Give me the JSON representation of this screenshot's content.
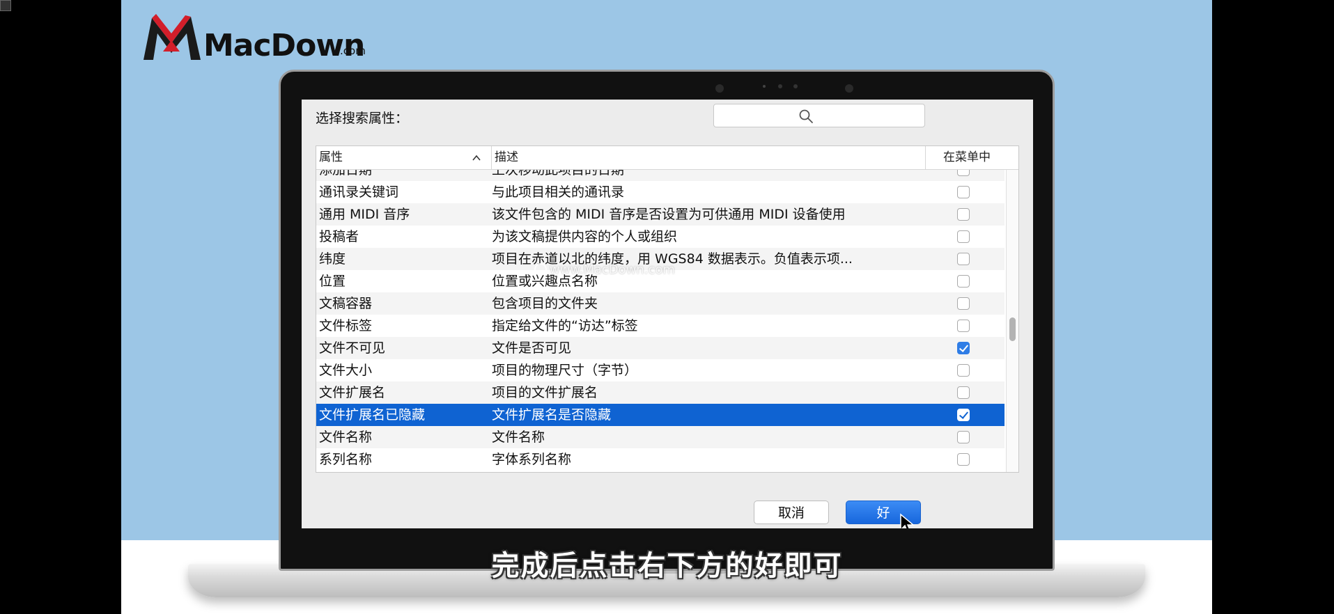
{
  "logo": {
    "brand": "MacDown",
    "brand_suffix": ".com"
  },
  "dialog": {
    "header_label": "选择搜索属性：",
    "search": {
      "placeholder": "",
      "value": ""
    },
    "columns": {
      "attribute": "属性",
      "description": "描述",
      "in_menu": "在菜单中"
    },
    "rows": [
      {
        "attribute": "添加日期",
        "description": "上次移动此项目的日期",
        "in_menu": false
      },
      {
        "attribute": "通讯录关键词",
        "description": "与此项目相关的通讯录",
        "in_menu": false
      },
      {
        "attribute": "通用 MIDI 音序",
        "description": "该文件包含的 MIDI 音序是否设置为可供通用 MIDI 设备使用",
        "in_menu": false
      },
      {
        "attribute": "投稿者",
        "description": "为该文稿提供内容的个人或组织",
        "in_menu": false
      },
      {
        "attribute": "纬度",
        "description": "项目在赤道以北的纬度，用 WGS84 数据表示。负值表示项...",
        "in_menu": false
      },
      {
        "attribute": "位置",
        "description": "位置或兴趣点名称",
        "in_menu": false
      },
      {
        "attribute": "文稿容器",
        "description": "包含项目的文件夹",
        "in_menu": false
      },
      {
        "attribute": "文件标签",
        "description": "指定给文件的“访达”标签",
        "in_menu": false
      },
      {
        "attribute": "文件不可见",
        "description": "文件是否可见",
        "in_menu": true
      },
      {
        "attribute": "文件大小",
        "description": "项目的物理尺寸（字节）",
        "in_menu": false
      },
      {
        "attribute": "文件扩展名",
        "description": "项目的文件扩展名",
        "in_menu": false
      },
      {
        "attribute": "文件扩展名已隐藏",
        "description": "文件扩展名是否隐藏",
        "in_menu": true,
        "selected": true
      },
      {
        "attribute": "文件名称",
        "description": "文件名称",
        "in_menu": false
      },
      {
        "attribute": "系列名称",
        "description": "字体系列名称",
        "in_menu": false
      }
    ],
    "buttons": {
      "cancel": "取消",
      "ok": "好"
    },
    "scroll_position": 0.53
  },
  "watermark": "www.MacDown.com",
  "subtitle": "完成后点击右下方的好即可",
  "colors": {
    "selection": "#0f63d2",
    "accent": "#2f7de6",
    "background": "#9cc6e6"
  }
}
